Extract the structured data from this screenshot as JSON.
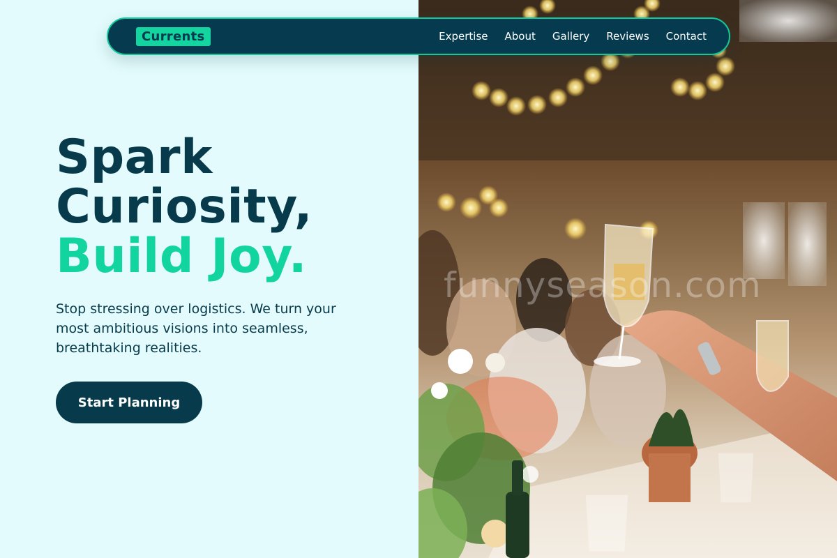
{
  "brand": {
    "logo_text": "Currents"
  },
  "nav": {
    "links": [
      "Expertise",
      "About",
      "Gallery",
      "Reviews",
      "Contact"
    ]
  },
  "hero": {
    "headline_line1": "Spark",
    "headline_line2": "Curiosity,",
    "headline_accent": "Build Joy.",
    "lead": "Stop stressing over logistics. We turn your most ambitious visions into seamless, breathtaking realities.",
    "cta_label": "Start Planning"
  },
  "photo": {
    "alt": "Guests raising champagne glasses at a candle-lit banquet hall",
    "watermark": "funnyseason.com"
  },
  "colors": {
    "page_bg": "#e3fbfc",
    "navy": "#073b4c",
    "accent": "#12d49e"
  }
}
